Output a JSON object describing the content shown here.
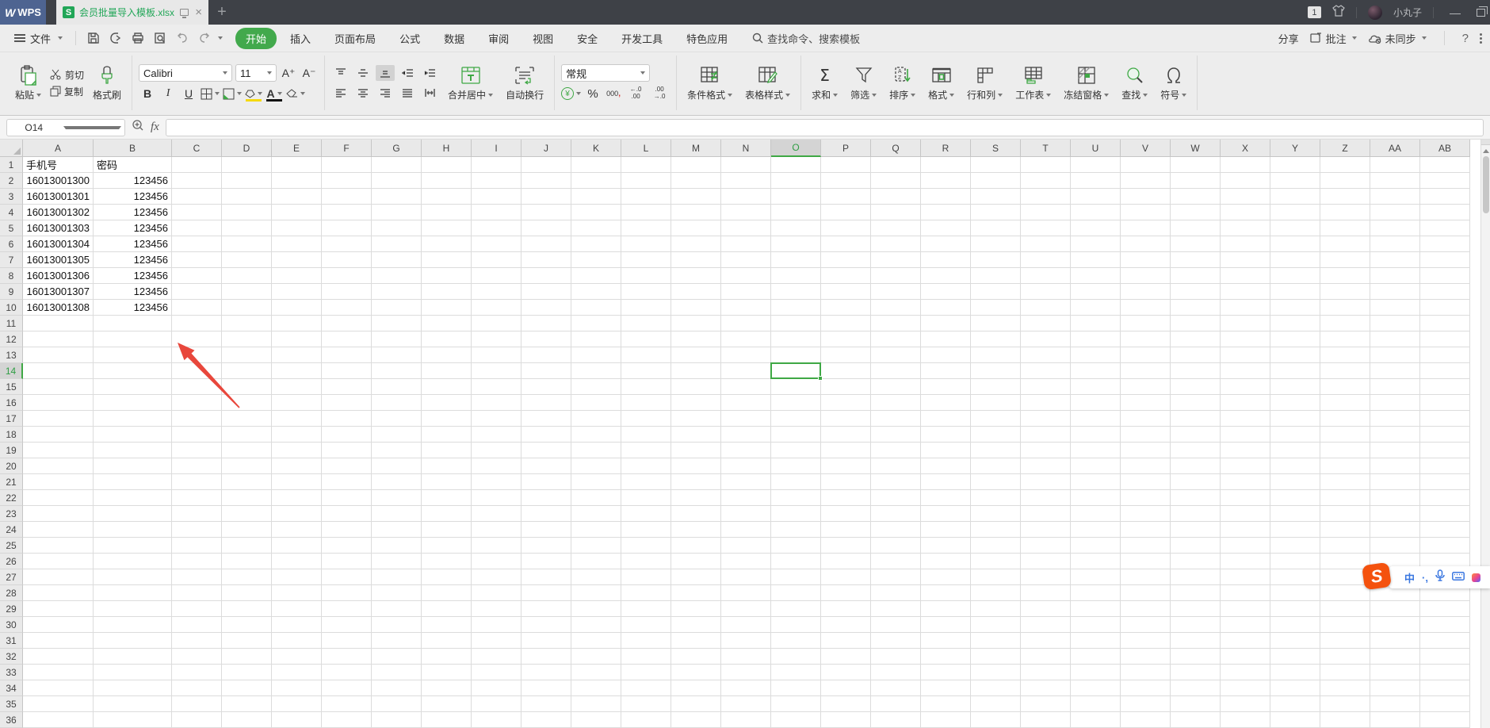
{
  "colors": {
    "brand_green": "#21a657",
    "accent_green": "#3fa845",
    "active_tab_green": "#42a94c",
    "arrow_red": "#e8473c",
    "titlebar_bg": "#3e4147",
    "logo_blue": "#4e6491",
    "sogou_orange": "#f4520e",
    "ime_blue": "#3a77e0"
  },
  "titlebar": {
    "app_name": "WPS",
    "doc_title": "会员批量导入模板.xlsx",
    "badge": "1",
    "username": "小丸子",
    "new_tab": "+"
  },
  "menubar": {
    "file_label": "文件",
    "tabs": [
      {
        "label": "开始",
        "active": true
      },
      {
        "label": "插入",
        "active": false
      },
      {
        "label": "页面布局",
        "active": false
      },
      {
        "label": "公式",
        "active": false
      },
      {
        "label": "数据",
        "active": false
      },
      {
        "label": "审阅",
        "active": false
      },
      {
        "label": "视图",
        "active": false
      },
      {
        "label": "安全",
        "active": false
      },
      {
        "label": "开发工具",
        "active": false
      },
      {
        "label": "特色应用",
        "active": false
      }
    ],
    "search_text": "查找命令、搜索模板",
    "share_label": "分享",
    "comment_label": "批注",
    "sync_label": "未同步",
    "help_label": "?"
  },
  "ribbon": {
    "clipboard": {
      "paste": "粘贴",
      "cut": "剪切",
      "copy": "复制",
      "format_painter": "格式刷"
    },
    "font": {
      "family": "Calibri",
      "size": "11",
      "grow": "A⁺",
      "shrink": "A⁻",
      "bold": "B",
      "italic": "I",
      "underline": "U"
    },
    "align": {
      "merge_center": "合并居中",
      "wrap_text": "自动换行"
    },
    "number": {
      "format": "常规",
      "currency": "¥",
      "percent": "%",
      "thousands": "000",
      "dec_inc": [
        "←.0",
        ".00"
      ],
      "dec_dec": [
        ".00",
        "→.0"
      ]
    },
    "format_tools": [
      {
        "label": "条件格式",
        "icon": "conditional-format-icon"
      },
      {
        "label": "表格样式",
        "icon": "table-style-icon"
      }
    ],
    "tools": [
      {
        "label": "求和",
        "icon": "sum-icon"
      },
      {
        "label": "筛选",
        "icon": "filter-icon"
      },
      {
        "label": "排序",
        "icon": "sort-icon"
      },
      {
        "label": "格式",
        "icon": "format-icon"
      },
      {
        "label": "行和列",
        "icon": "rows-columns-icon"
      },
      {
        "label": "工作表",
        "icon": "worksheet-icon"
      },
      {
        "label": "冻结窗格",
        "icon": "freeze-panes-icon"
      },
      {
        "label": "查找",
        "icon": "find-icon"
      },
      {
        "label": "符号",
        "icon": "symbol-icon"
      }
    ]
  },
  "formula_bar": {
    "name_box": "O14",
    "fx_label": "fx",
    "formula_value": ""
  },
  "sheet": {
    "columns": [
      "A",
      "B",
      "C",
      "D",
      "E",
      "F",
      "G",
      "H",
      "I",
      "J",
      "K",
      "L",
      "M",
      "N",
      "O",
      "P",
      "Q",
      "R",
      "S",
      "T",
      "U",
      "V",
      "W",
      "X",
      "Y",
      "Z",
      "AA",
      "AB"
    ],
    "row_count": 36,
    "selected_cell": "O14",
    "selected_column": "O",
    "selected_row": 14,
    "cells": [
      [
        "手机号",
        "密码"
      ],
      [
        "16013001300",
        "123456"
      ],
      [
        "16013001301",
        "123456"
      ],
      [
        "16013001302",
        "123456"
      ],
      [
        "16013001303",
        "123456"
      ],
      [
        "16013001304",
        "123456"
      ],
      [
        "16013001305",
        "123456"
      ],
      [
        "16013001306",
        "123456"
      ],
      [
        "16013001307",
        "123456"
      ],
      [
        "16013001308",
        "123456"
      ]
    ]
  },
  "ime": {
    "mode_label": "中",
    "punctuation_label": "·,",
    "logo_letter": "S"
  }
}
